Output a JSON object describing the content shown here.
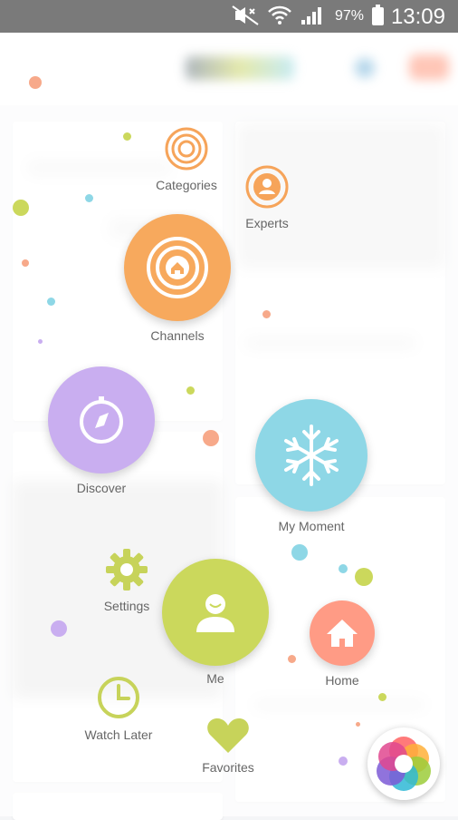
{
  "status_bar": {
    "battery_percent": "97%",
    "time": "13:09",
    "icons": [
      "mute-icon",
      "wifi-icon",
      "signal-icon",
      "battery-icon"
    ]
  },
  "menu": {
    "items": [
      {
        "key": "categories",
        "label": "Categories",
        "icon": "target-icon",
        "color": "#f6a45a"
      },
      {
        "key": "experts",
        "label": "Experts",
        "icon": "person-target-icon",
        "color": "#f6a45a"
      },
      {
        "key": "channels",
        "label": "Channels",
        "icon": "home-target-icon",
        "color": "#f7a95d"
      },
      {
        "key": "discover",
        "label": "Discover",
        "icon": "compass-icon",
        "color": "#c9aef0"
      },
      {
        "key": "my_moment",
        "label": "My Moment",
        "icon": "snowflake-icon",
        "color": "#8ed7e6"
      },
      {
        "key": "settings",
        "label": "Settings",
        "icon": "gear-icon",
        "color": "#c7d35a"
      },
      {
        "key": "me",
        "label": "Me",
        "icon": "user-icon",
        "color": "#cbd85c"
      },
      {
        "key": "home",
        "label": "Home",
        "icon": "home-icon",
        "color": "#ff9b85"
      },
      {
        "key": "watch_later",
        "label": "Watch Later",
        "icon": "clock-icon",
        "color": "#c7d35a"
      },
      {
        "key": "favorites",
        "label": "Favorites",
        "icon": "heart-icon",
        "color": "#c7d35a"
      }
    ]
  },
  "fab": {
    "icon": "color-wheel-icon"
  }
}
